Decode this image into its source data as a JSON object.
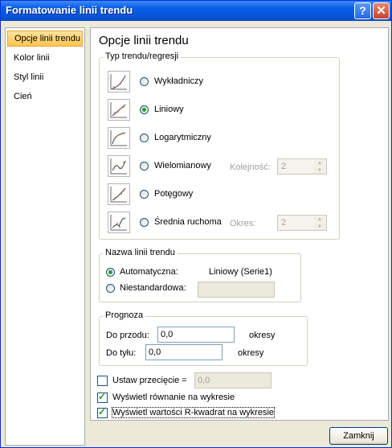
{
  "window": {
    "title": "Formatowanie linii trendu"
  },
  "titlebar": {
    "help": "?",
    "close": "✕"
  },
  "sidebar": {
    "items": [
      {
        "label": "Opcje linii trendu",
        "active": true
      },
      {
        "label": "Kolor linii"
      },
      {
        "label": "Styl linii"
      },
      {
        "label": "Cień"
      }
    ]
  },
  "main": {
    "heading": "Opcje linii trendu",
    "type_group": {
      "legend": "Typ trendu/regresji",
      "options": [
        {
          "label": "Wykładniczy",
          "checked": false,
          "icon": "exponential-trend-icon"
        },
        {
          "label": "Liniowy",
          "checked": true,
          "icon": "linear-trend-icon"
        },
        {
          "label": "Logarytmiczny",
          "checked": false,
          "icon": "logarithmic-trend-icon"
        },
        {
          "label": "Wielomianowy",
          "checked": false,
          "icon": "polynomial-trend-icon"
        },
        {
          "label": "Potęgowy",
          "checked": false,
          "icon": "power-trend-icon"
        },
        {
          "label": "Średnia ruchoma",
          "checked": false,
          "icon": "moving-average-icon"
        }
      ],
      "order_label": "Kolejność:",
      "order_value": "2",
      "period_label": "Okres:",
      "period_value": "2"
    },
    "name_group": {
      "legend": "Nazwa linii trendu",
      "automatic_label": "Automatyczna:",
      "automatic_value": "Liniowy (Serie1)",
      "custom_label": "Niestandardowa:",
      "custom_value": ""
    },
    "forecast_group": {
      "legend": "Prognoza",
      "forward_label": "Do przodu:",
      "forward_value": "0,0",
      "forward_unit": "okresy",
      "backward_label": "Do tyłu:",
      "backward_value": "0,0",
      "backward_unit": "okresy"
    },
    "intercept": {
      "label": "Ustaw przecięcie =",
      "value": "0,0",
      "checked": false
    },
    "show_equation": {
      "label": "Wyświetl równanie na wykresie",
      "checked": true
    },
    "show_r2": {
      "label": "Wyświetl wartości R-kwadrat na wykresie",
      "checked": true
    }
  },
  "footer": {
    "close_label": "Zamknij"
  },
  "colors": {
    "title_bar": "#0a5fe8",
    "active_item": "#ffc54f",
    "check": "#21a121"
  }
}
